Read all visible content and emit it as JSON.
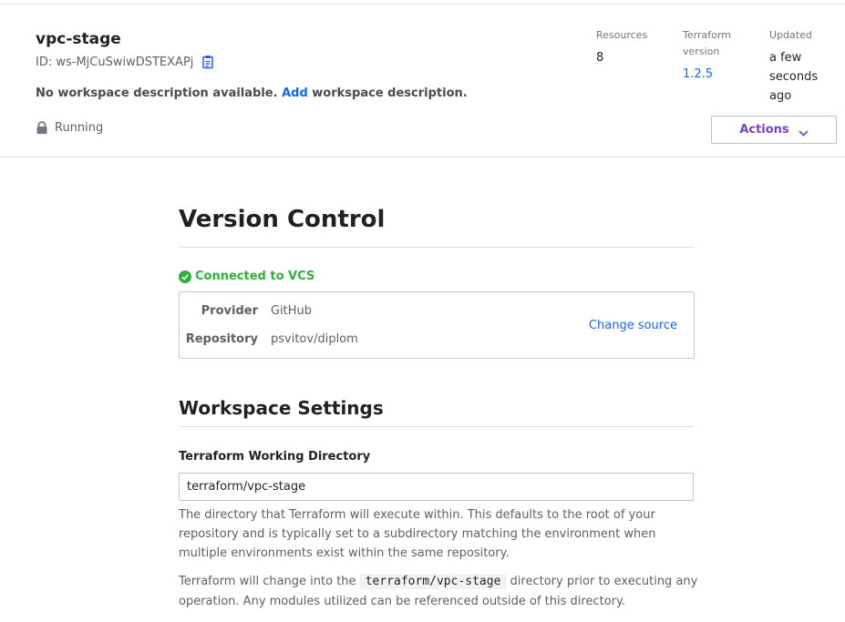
{
  "workspace": {
    "name": "vpc-stage",
    "id_label": "ID: ws-MjCuSwiwDSTEXAPj",
    "desc_prefix": "No workspace description available.",
    "desc_link": "Add",
    "desc_suffix": "workspace description.",
    "status": "Running"
  },
  "meta": {
    "resources_label": "Resources",
    "resources_value": "8",
    "tf_label": "Terraform version",
    "tf_value": "1.2.5",
    "updated_label": "Updated",
    "updated_value": "a few seconds ago"
  },
  "actions_label": "Actions",
  "version_control": {
    "heading": "Version Control",
    "status": "Connected to VCS",
    "provider_label": "Provider",
    "provider_value": "GitHub",
    "repo_label": "Repository",
    "repo_value": "psvitov/diplom",
    "change_source": "Change source"
  },
  "settings": {
    "heading": "Workspace Settings",
    "field_label": "Terraform Working Directory",
    "field_value": "terraform/vpc-stage",
    "help1": "The directory that Terraform will execute within. This defaults to the root of your repository and is typically set to a subdirectory matching the environment when multiple environments exist within the same repository.",
    "help2_prefix": "Terraform will change into the",
    "help2_code": "terraform/vpc-stage",
    "help2_suffix": "directory prior to executing any operation. Any modules utilized can be referenced outside of this directory."
  },
  "colors": {
    "link": "#1563ff",
    "success": "#2eb039",
    "actions": "#7b42bc"
  },
  "icons": [
    "copy-icon",
    "lock-icon",
    "chevron-down-icon",
    "check-circle-icon"
  ]
}
